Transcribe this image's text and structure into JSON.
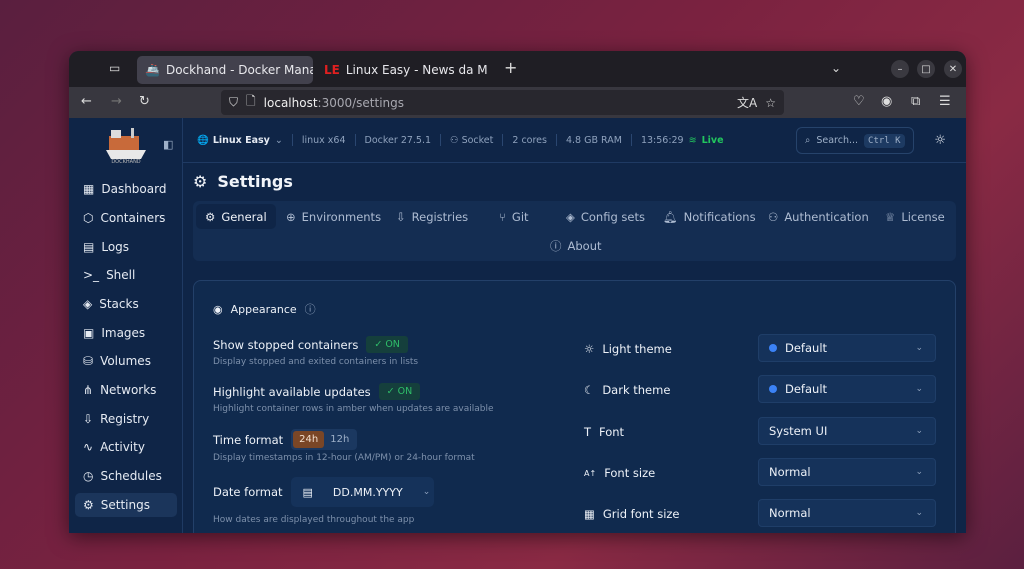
{
  "browser": {
    "tabs": [
      {
        "label": "Dockhand - Docker Manag",
        "active": true
      },
      {
        "label": "Linux Easy - News da Mon",
        "active": false
      }
    ],
    "url_host": "localhost",
    "url_path": ":3000/settings"
  },
  "app": {
    "logo_text": "DOCKHAND",
    "sidebar": [
      {
        "label": "Dashboard",
        "icon": "dashboard-icon"
      },
      {
        "label": "Containers",
        "icon": "box-icon"
      },
      {
        "label": "Logs",
        "icon": "logs-icon"
      },
      {
        "label": "Shell",
        "icon": "terminal-icon"
      },
      {
        "label": "Stacks",
        "icon": "layers-icon"
      },
      {
        "label": "Images",
        "icon": "image-icon"
      },
      {
        "label": "Volumes",
        "icon": "database-icon"
      },
      {
        "label": "Networks",
        "icon": "network-icon"
      },
      {
        "label": "Registry",
        "icon": "registry-icon"
      },
      {
        "label": "Activity",
        "icon": "activity-icon"
      },
      {
        "label": "Schedules",
        "icon": "clock-icon"
      },
      {
        "label": "Settings",
        "icon": "gear-icon",
        "selected": true
      }
    ],
    "topbar": {
      "environment": "Linux Easy",
      "platform": "linux x64",
      "docker": "Docker 27.5.1",
      "connection": "Socket",
      "cores": "2 cores",
      "ram": "4.8 GB RAM",
      "time": "13:56:29",
      "status": "Live",
      "status_color": "#22c55e",
      "search_placeholder": "Search...",
      "shortcut": "Ctrl K"
    },
    "page_title": "Settings",
    "tabs": [
      "General",
      "Environments",
      "Registries",
      "Git",
      "Config sets",
      "Notifications",
      "Authentication",
      "License",
      "About"
    ],
    "section": "Appearance",
    "settings": {
      "show_stopped": {
        "label": "Show stopped containers",
        "value": "ON",
        "desc": "Display stopped and exited containers in lists"
      },
      "highlight_updates": {
        "label": "Highlight available updates",
        "value": "ON",
        "desc": "Highlight container rows in amber when updates are available"
      },
      "time_format": {
        "label": "Time format",
        "options": [
          "24h",
          "12h"
        ],
        "selected": "24h",
        "desc": "Display timestamps in 12-hour (AM/PM) or 24-hour format"
      },
      "date_format": {
        "label": "Date format",
        "value": "DD.MM.YYYY",
        "desc": "How dates are displayed throughout the app"
      },
      "light_theme": {
        "label": "Light theme",
        "value": "Default"
      },
      "dark_theme": {
        "label": "Dark theme",
        "value": "Default"
      },
      "font": {
        "label": "Font",
        "value": "System UI"
      },
      "font_size": {
        "label": "Font size",
        "value": "Normal"
      },
      "grid_font_size": {
        "label": "Grid font size",
        "value": "Normal"
      }
    }
  }
}
